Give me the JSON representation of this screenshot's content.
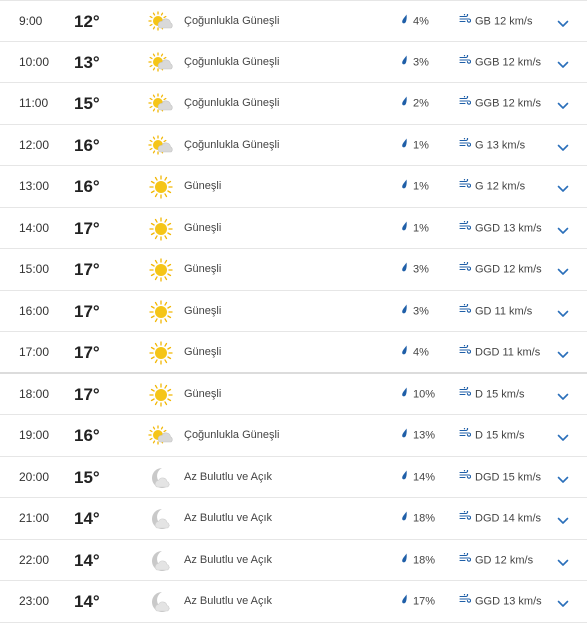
{
  "forecast": {
    "rows": [
      {
        "time": "9:00",
        "temp": "12°",
        "icon": "mostly-sunny-icon",
        "condition": "Çoğunlukla Güneşli",
        "precip": "4%",
        "wind": "GB 12 km/s"
      },
      {
        "time": "10:00",
        "temp": "13°",
        "icon": "mostly-sunny-icon",
        "condition": "Çoğunlukla Güneşli",
        "precip": "3%",
        "wind": "GGB 12 km/s"
      },
      {
        "time": "11:00",
        "temp": "15°",
        "icon": "mostly-sunny-icon",
        "condition": "Çoğunlukla Güneşli",
        "precip": "2%",
        "wind": "GGB 12 km/s"
      },
      {
        "time": "12:00",
        "temp": "16°",
        "icon": "mostly-sunny-icon",
        "condition": "Çoğunlukla Güneşli",
        "precip": "1%",
        "wind": "G 13 km/s"
      },
      {
        "time": "13:00",
        "temp": "16°",
        "icon": "sunny-icon",
        "condition": "Güneşli",
        "precip": "1%",
        "wind": "G 12 km/s"
      },
      {
        "time": "14:00",
        "temp": "17°",
        "icon": "sunny-icon",
        "condition": "Güneşli",
        "precip": "1%",
        "wind": "GGD 13 km/s"
      },
      {
        "time": "15:00",
        "temp": "17°",
        "icon": "sunny-icon",
        "condition": "Güneşli",
        "precip": "3%",
        "wind": "GGD 12 km/s"
      },
      {
        "time": "16:00",
        "temp": "17°",
        "icon": "sunny-icon",
        "condition": "Güneşli",
        "precip": "3%",
        "wind": "GD 11 km/s"
      },
      {
        "time": "17:00",
        "temp": "17°",
        "icon": "sunny-icon",
        "condition": "Güneşli",
        "precip": "4%",
        "wind": "DGD 11 km/s"
      },
      {
        "time": "18:00",
        "temp": "17°",
        "icon": "sunny-icon",
        "condition": "Güneşli",
        "precip": "10%",
        "wind": "D 15 km/s"
      },
      {
        "time": "19:00",
        "temp": "16°",
        "icon": "mostly-sunny-icon",
        "condition": "Çoğunlukla Güneşli",
        "precip": "13%",
        "wind": "D 15 km/s"
      },
      {
        "time": "20:00",
        "temp": "15°",
        "icon": "partly-clear-night-icon",
        "condition": "Az Bulutlu ve Açık",
        "precip": "14%",
        "wind": "DGD 15 km/s"
      },
      {
        "time": "21:00",
        "temp": "14°",
        "icon": "partly-clear-night-icon",
        "condition": "Az Bulutlu ve Açık",
        "precip": "18%",
        "wind": "DGD 14 km/s"
      },
      {
        "time": "22:00",
        "temp": "14°",
        "icon": "partly-clear-night-icon",
        "condition": "Az Bulutlu ve Açık",
        "precip": "18%",
        "wind": "GD 12 km/s"
      },
      {
        "time": "23:00",
        "temp": "14°",
        "icon": "partly-clear-night-icon",
        "condition": "Az Bulutlu ve Açık",
        "precip": "17%",
        "wind": "GGD 13 km/s"
      }
    ]
  },
  "colors": {
    "sun": "#f5c518",
    "sun_ray": "#f2b705",
    "cloud": "#d9d9d9",
    "moon": "#c9c9c9",
    "drop": "#1f5fa8",
    "wind": "#1f5fa8",
    "chevron": "#2a6fba"
  }
}
